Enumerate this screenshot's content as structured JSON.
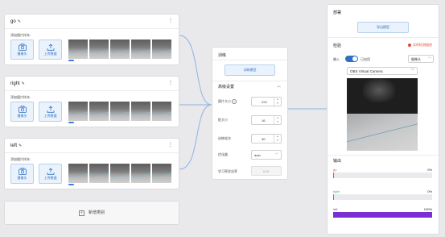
{
  "classes": [
    {
      "name": "go",
      "add_label": "添加图片样本:",
      "webcam_label": "摄像头",
      "upload_label": "上传数据",
      "thumb_count": 5
    },
    {
      "name": "right",
      "add_label": "添加图片样本:",
      "webcam_label": "摄像头",
      "upload_label": "上传数据",
      "thumb_count": 5
    },
    {
      "name": "left",
      "add_label": "添加图片样本:",
      "webcam_label": "摄像头",
      "upload_label": "上传数据",
      "thumb_count": 5
    }
  ],
  "new_class_label": "新增类别",
  "training": {
    "title": "训练",
    "train_button": "训练模型",
    "advanced_label": "高级设置",
    "fields": [
      {
        "label": "图片大小",
        "value": "224",
        "type": "number"
      },
      {
        "label": "批大小",
        "value": "16",
        "type": "number"
      },
      {
        "label": "训练轮次",
        "value": "30",
        "type": "number"
      },
      {
        "label": "优化器",
        "value": "auto",
        "type": "select"
      },
      {
        "label": "学习率优化率",
        "value": "0.01",
        "type": "disabled"
      }
    ]
  },
  "preview": {
    "deploy_title": "部署",
    "export_button": "导出模型",
    "check_title": "检验",
    "realtime_label": "实时检测描述",
    "input_label": "输入",
    "toggle_label": "已启用",
    "source_select": "摄像头",
    "device_select": "OBS Virtual Camera",
    "output_title": "输出",
    "outputs": [
      {
        "name": "go",
        "percent_label": "0%",
        "value": 0,
        "color": "#e3524a"
      },
      {
        "name": "right",
        "percent_label": "0%",
        "value": 0,
        "color": "#2eaf5a"
      },
      {
        "name": "left",
        "percent_label": "100%",
        "value": 100,
        "color": "#7a2fd3"
      }
    ]
  },
  "colors": {
    "accent": "#2f6fc4",
    "connector": "#8db3e2"
  }
}
